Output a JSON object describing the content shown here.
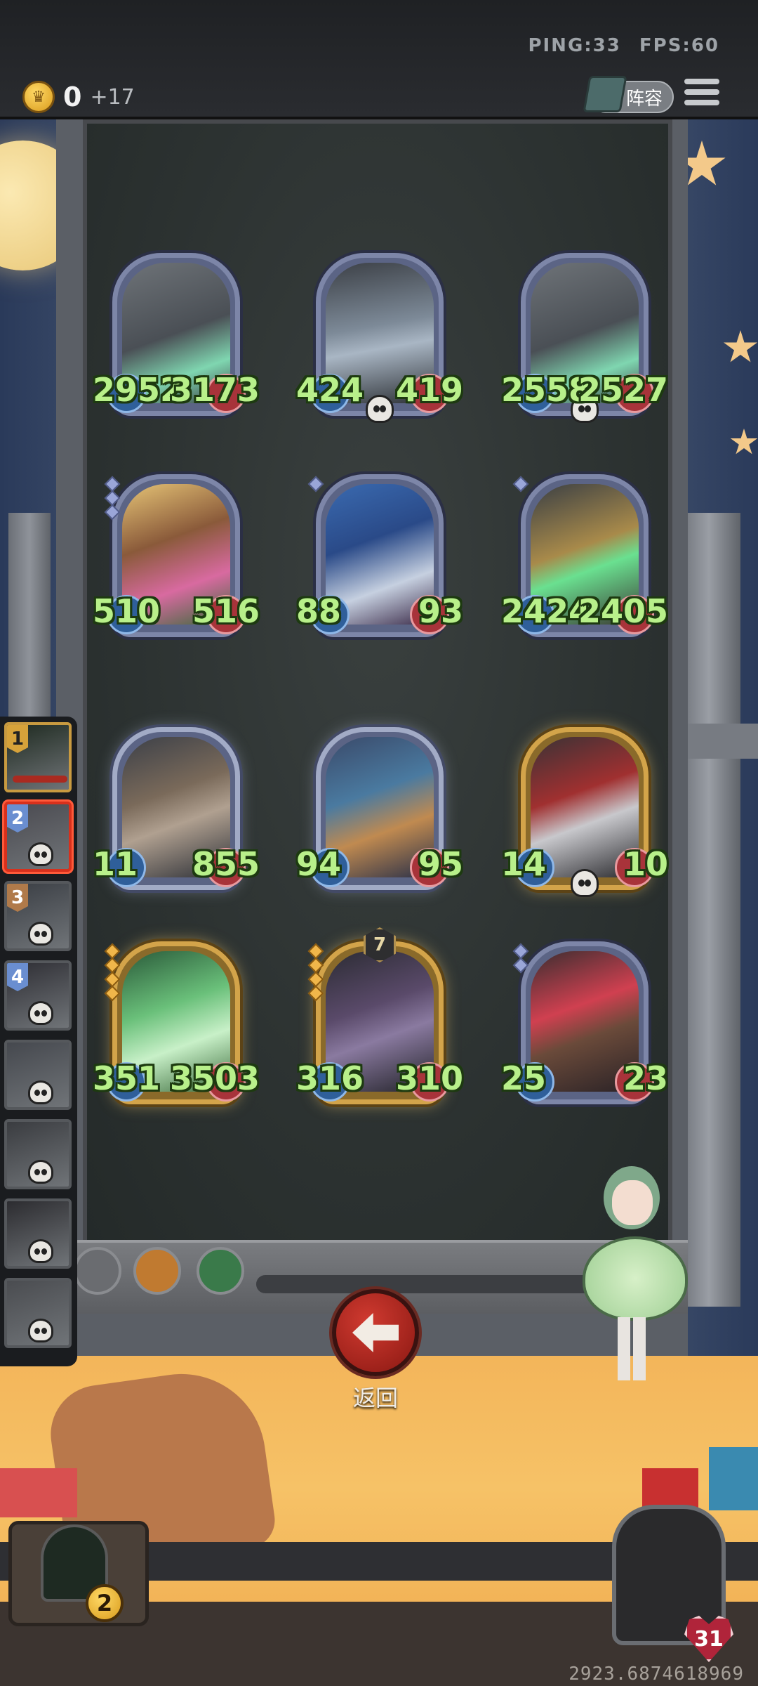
{
  "hud": {
    "ping": "PING:33",
    "fps": "FPS:60",
    "gold": "0",
    "gold_income": "+17",
    "lineup_label": "阵容"
  },
  "board": {
    "rows": [
      [
        {
          "attack": "2952",
          "health": "3173",
          "tier": "none",
          "frame": "blue",
          "skull": false,
          "art": "grey-shark-monster"
        },
        {
          "attack": "424",
          "health": "419",
          "tier": "none",
          "frame": "blue",
          "skull": true,
          "art": "lightbulb-robot"
        },
        {
          "attack": "2558",
          "health": "2527",
          "tier": "none",
          "frame": "blue",
          "skull": true,
          "art": "grey-shark-monster"
        }
      ],
      [
        {
          "attack": "510",
          "health": "516",
          "tier": "blue-3",
          "frame": "blue",
          "skull": false,
          "art": "flower-witch"
        },
        {
          "attack": "88",
          "health": "93",
          "tier": "blue-1",
          "frame": "blue",
          "skull": false,
          "art": "blue-haired-imp"
        },
        {
          "attack": "2424",
          "health": "2405",
          "tier": "blue-1",
          "frame": "blue",
          "skull": false,
          "art": "brass-golem"
        }
      ],
      [
        {
          "attack": "11",
          "health": "855",
          "tier": "none",
          "frame": "silver",
          "skull": false,
          "art": "horned-warrior"
        },
        {
          "attack": "94",
          "health": "95",
          "tier": "none",
          "frame": "silver",
          "skull": false,
          "art": "blue-beast"
        },
        {
          "attack": "14",
          "health": "10",
          "tier": "none",
          "frame": "gold",
          "skull": true,
          "art": "hooded-knight"
        }
      ],
      [
        {
          "attack": "351",
          "health": "3503",
          "tier": "gold-4",
          "frame": "gold",
          "skull": false,
          "art": "forest-fairy"
        },
        {
          "attack": "316",
          "health": "310",
          "tier": "gold-4",
          "frame": "gold",
          "skull": false,
          "art": "hat-gunslinger",
          "star": "7"
        },
        {
          "attack": "25",
          "health": "23",
          "tier": "blue-2",
          "frame": "blue",
          "skull": false,
          "art": "pirate-captain"
        }
      ]
    ]
  },
  "roster": [
    {
      "rank": "1",
      "style": "gold",
      "dead": false
    },
    {
      "rank": "2",
      "style": "blue",
      "dead": true,
      "active": true
    },
    {
      "rank": "3",
      "style": "bronze",
      "dead": true
    },
    {
      "rank": "4",
      "style": "blue",
      "dead": true
    },
    {
      "rank": "",
      "style": "none",
      "dead": true
    },
    {
      "rank": "",
      "style": "none",
      "dead": true
    },
    {
      "rank": "",
      "style": "none",
      "dead": true
    },
    {
      "rank": "",
      "style": "none",
      "dead": true
    }
  ],
  "back_label": "返回",
  "bag_count": "2",
  "player_health": "31",
  "version_text": "2923.6874618969",
  "colors": {
    "stat_green": "#b8f08a",
    "back_red": "#c0302a",
    "board": "#2c3231",
    "floor": "#f3b55a"
  }
}
